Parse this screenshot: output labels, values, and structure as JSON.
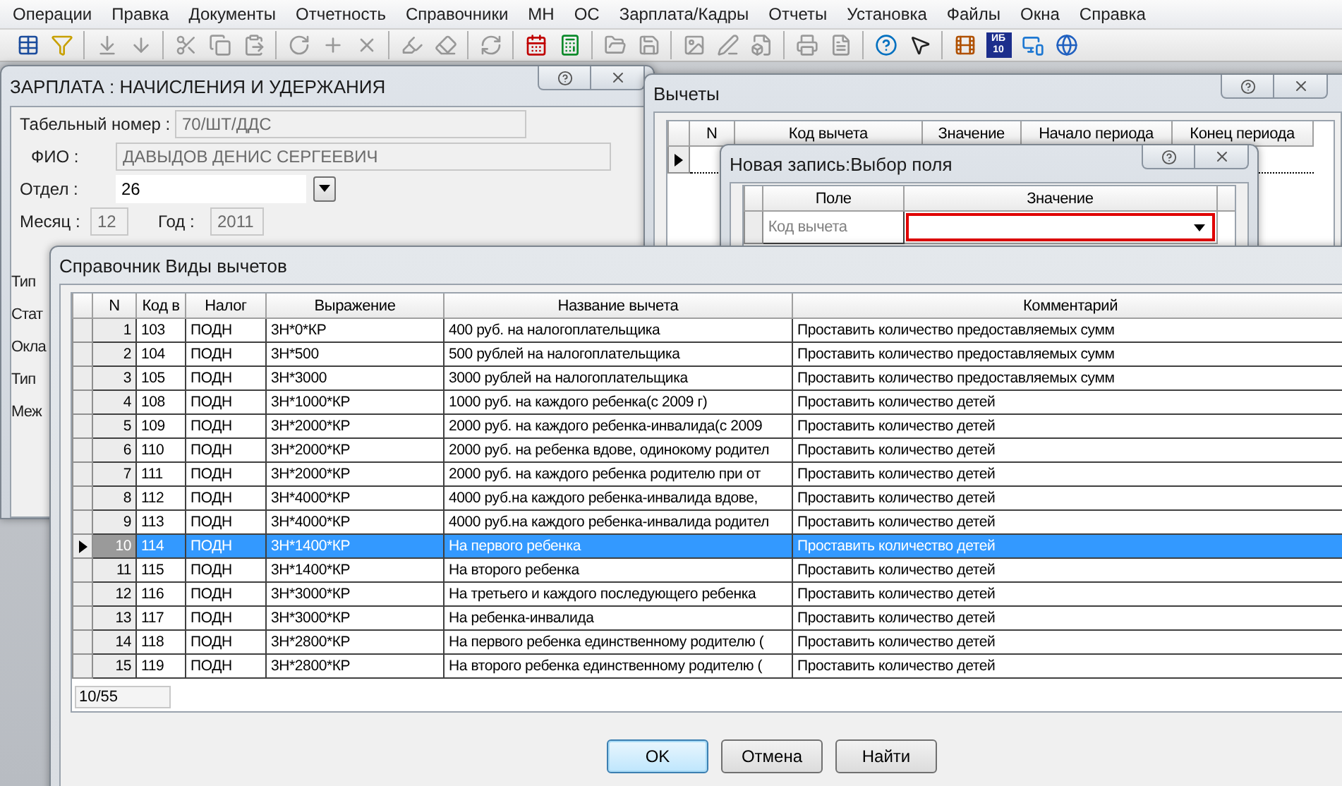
{
  "menu": [
    "Операции",
    "Правка",
    "Документы",
    "Отчетность",
    "Справочники",
    "МН",
    "ОС",
    "Зарплата/Кадры",
    "Отчеты",
    "Установка",
    "Файлы",
    "Окна",
    "Справка"
  ],
  "toolbar": [
    [
      {
        "disabled": false
      },
      {
        "disabled": false
      }
    ],
    [
      {
        "disabled": true
      },
      {
        "disabled": true
      }
    ],
    [
      {
        "disabled": true
      },
      {
        "disabled": true
      },
      {
        "disabled": true
      }
    ],
    [
      {
        "disabled": true
      },
      {
        "disabled": true
      },
      {
        "disabled": true
      }
    ],
    [
      {
        "disabled": true
      },
      {
        "disabled": true
      }
    ],
    [
      {
        "disabled": true
      }
    ],
    [
      {
        "disabled": false
      },
      {
        "disabled": false
      }
    ],
    [
      {
        "disabled": true
      },
      {
        "disabled": true
      }
    ],
    [
      {
        "disabled": true
      },
      {
        "disabled": true
      },
      {
        "disabled": true
      }
    ],
    [
      {
        "disabled": true
      },
      {
        "disabled": true
      }
    ],
    [
      {
        "disabled": false
      },
      {
        "disabled": false
      }
    ],
    [
      {
        "disabled": false
      },
      {
        "disabled": false,
        "label": "ИБ 10"
      },
      {
        "disabled": false
      },
      {
        "disabled": false
      }
    ]
  ],
  "payroll_window": {
    "title": "ЗАРПЛАТА : НАЧИСЛЕНИЯ И УДЕРЖАНИЯ",
    "employee_id": {
      "label": "Табельный номер :",
      "value": "70/ШТ/ДДС",
      "disabled": true
    },
    "full_name": {
      "label": "ФИО :",
      "value": "ДАВЫДОВ ДЕНИС СЕРГЕЕВИЧ",
      "disabled": true
    },
    "department": {
      "label": "Отдел :",
      "value": "26",
      "disabled": false
    },
    "month": {
      "label": "Месяц :",
      "value": "12",
      "disabled": true
    },
    "year": {
      "label": "Год :",
      "value": "2011",
      "disabled": true
    },
    "cut_labels": [
      "Тип",
      "Стат",
      "Окла",
      "Тип",
      "Меж"
    ]
  },
  "deductions_window": {
    "title": "Вычеты",
    "columns": [
      "N",
      "Код вычета",
      "Значение",
      "Начало периода",
      "Конец периода"
    ]
  },
  "new_record_window": {
    "title": "Новая запись:Выбор поля",
    "columns": [
      "Поле",
      "Значение"
    ],
    "rows": [
      {
        "field": "Код вычета"
      }
    ]
  },
  "catalog_window": {
    "title": "Справочник Виды вычетов",
    "columns": [
      "N",
      "Код в",
      "Налог",
      "Выражение",
      "Название вычета",
      "Комментарий"
    ],
    "rows": [
      {
        "n": "1",
        "code": "103",
        "tax": "ПОДН",
        "expression": "3Н*0*КР",
        "name": "400 руб. на налогоплательщика",
        "comment": "Проставить количество предоставляемых сумм",
        "selected": false
      },
      {
        "n": "2",
        "code": "104",
        "tax": "ПОДН",
        "expression": "3Н*500",
        "name": "500 рублей на налогоплательщика",
        "comment": "Проставить количество предоставляемых сумм",
        "selected": false
      },
      {
        "n": "3",
        "code": "105",
        "tax": "ПОДН",
        "expression": "3Н*3000",
        "name": "3000 рублей на налогоплательщика",
        "comment": "Проставить количество предоставляемых сумм",
        "selected": false
      },
      {
        "n": "4",
        "code": "108",
        "tax": "ПОДН",
        "expression": "3Н*1000*КР",
        "name": "1000 руб. на каждого ребенка(с 2009 г)",
        "comment": "Проставить количество детей",
        "selected": false
      },
      {
        "n": "5",
        "code": "109",
        "tax": "ПОДН",
        "expression": "3Н*2000*КР",
        "name": "2000 руб. на каждого ребенка-инвалида(с 2009",
        "comment": "Проставить количество детей",
        "selected": false
      },
      {
        "n": "6",
        "code": "110",
        "tax": "ПОДН",
        "expression": "3Н*2000*КР",
        "name": "2000 руб. на ребенка вдове, одинокому родител",
        "comment": "Проставить количество детей",
        "selected": false
      },
      {
        "n": "7",
        "code": "111",
        "tax": "ПОДН",
        "expression": "3Н*2000*КР",
        "name": "2000 руб. на каждого ребенка родителю при от",
        "comment": "Проставить количество детей",
        "selected": false
      },
      {
        "n": "8",
        "code": "112",
        "tax": "ПОДН",
        "expression": "3Н*4000*КР",
        "name": "4000 руб.на каждого ребенка-инвалида вдове,",
        "comment": "Проставить количество детей",
        "selected": false
      },
      {
        "n": "9",
        "code": "113",
        "tax": "ПОДН",
        "expression": "3Н*4000*КР",
        "name": "4000 руб.на каждого ребенка-инвалида родител",
        "comment": "Проставить количество детей",
        "selected": false
      },
      {
        "n": "10",
        "code": "114",
        "tax": "ПОДН",
        "expression": "3Н*1400*КР",
        "name": "На первого ребенка",
        "comment": "Проставить количество детей",
        "selected": true
      },
      {
        "n": "11",
        "code": "115",
        "tax": "ПОДН",
        "expression": "3Н*1400*КР",
        "name": "На второго ребенка",
        "comment": "Проставить количество детей",
        "selected": false
      },
      {
        "n": "12",
        "code": "116",
        "tax": "ПОДН",
        "expression": "3Н*3000*КР",
        "name": "На третьего и каждого последующего ребенка",
        "comment": "Проставить количество детей",
        "selected": false
      },
      {
        "n": "13",
        "code": "117",
        "tax": "ПОДН",
        "expression": "3Н*3000*КР",
        "name": "На ребенка-инвалида",
        "comment": "Проставить количество детей",
        "selected": false
      },
      {
        "n": "14",
        "code": "118",
        "tax": "ПОДН",
        "expression": "3Н*2800*КР",
        "name": "На первого ребенка единственному родителю (",
        "comment": "Проставить количество детей",
        "selected": false
      },
      {
        "n": "15",
        "code": "119",
        "tax": "ПОДН",
        "expression": "3Н*2800*КР",
        "name": "На второго ребенка единственному родителю (",
        "comment": "Проставить количество детей",
        "selected": false
      }
    ],
    "status": "10/55",
    "buttons": [
      {
        "label": "OK",
        "default": true
      },
      {
        "label": "Отмена",
        "default": false
      },
      {
        "label": "Найти",
        "default": false
      }
    ]
  }
}
